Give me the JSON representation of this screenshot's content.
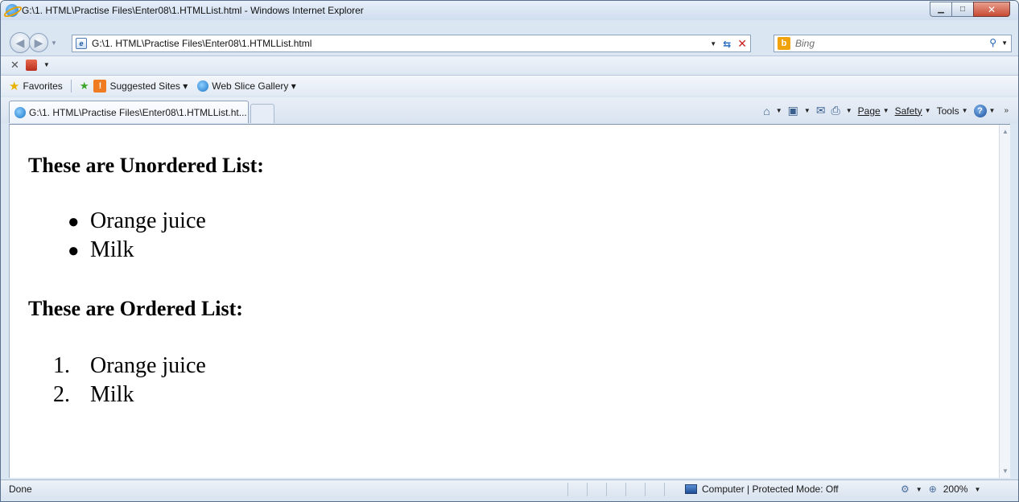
{
  "window": {
    "title": "G:\\1. HTML\\Practise Files\\Enter08\\1.HTMLList.html - Windows Internet Explorer"
  },
  "address_bar": {
    "url": "G:\\1. HTML\\Practise Files\\Enter08\\1.HTMLList.html"
  },
  "search": {
    "placeholder": "Bing"
  },
  "favorites_bar": {
    "favorites_label": "Favorites",
    "items": [
      "Suggested Sites ▾",
      "Web Slice Gallery ▾"
    ]
  },
  "tabs": [
    {
      "label": "G:\\1. HTML\\Practise Files\\Enter08\\1.HTMLList.ht..."
    }
  ],
  "command_bar": {
    "page_label": "Page",
    "safety_label": "Safety",
    "tools_label": "Tools"
  },
  "content": {
    "unordered_heading": "These are Unordered List:",
    "unordered_items": [
      "Orange juice",
      "Milk"
    ],
    "ordered_heading": "These are Ordered List:",
    "ordered_numbers": [
      "1.",
      "2."
    ],
    "ordered_items": [
      "Orange juice",
      "Milk"
    ]
  },
  "status_bar": {
    "status_text": "Done",
    "zone_text": "Computer | Protected Mode: Off",
    "zoom_text": "200%"
  },
  "colors": {
    "chrome": "#dbe6f3",
    "close_button": "#c84a33",
    "accent_blue": "#1d5fb4"
  }
}
